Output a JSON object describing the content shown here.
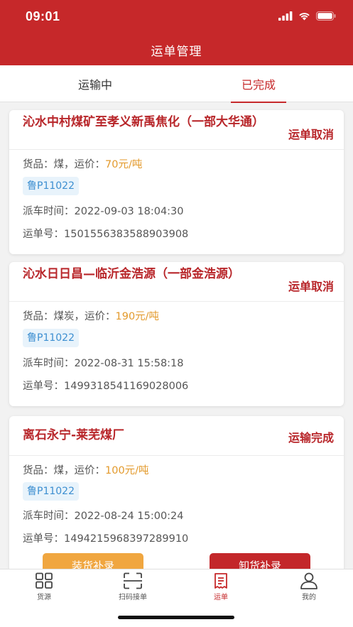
{
  "status_bar": {
    "time": "09:01"
  },
  "header": {
    "title": "运单管理"
  },
  "tabs": [
    {
      "label": "运输中",
      "active": false
    },
    {
      "label": "已完成",
      "active": true
    }
  ],
  "waybills": [
    {
      "route": "沁水中村煤矿至孝义新禹焦化（一部大华通）",
      "action": "运单取消",
      "goods_label": "货品：",
      "goods": "煤，",
      "price_label": "运价：",
      "price": "70元/吨",
      "plate": "鲁P11022",
      "dispatch_label": "派车时间：",
      "dispatch_time": "2022-09-03 18:04:30",
      "waybill_label": "运单号：",
      "waybill_no": "1501556383588903908"
    },
    {
      "route": "沁水日日昌—临沂金浩源（一部金浩源）",
      "action": "运单取消",
      "goods_label": "货品：",
      "goods": "煤炭，",
      "price_label": "运价：",
      "price": "190元/吨",
      "plate": "鲁P11022",
      "dispatch_label": "派车时间：",
      "dispatch_time": "2022-08-31 15:58:18",
      "waybill_label": "运单号：",
      "waybill_no": "1499318541169028006"
    },
    {
      "route": "离石永宁-莱芜煤厂",
      "action": "运输完成",
      "goods_label": "货品：",
      "goods": "煤，",
      "price_label": "运价：",
      "price": "100元/吨",
      "plate": "鲁P11022",
      "dispatch_label": "派车时间：",
      "dispatch_time": "2022-08-24 15:00:24",
      "waybill_label": "运单号：",
      "waybill_no": "1494215968397289910",
      "load_button": "装货补录",
      "unload_button": "卸货补录"
    }
  ],
  "bottom_nav": [
    {
      "label": "货源",
      "icon": "grid-icon",
      "active": false
    },
    {
      "label": "扫码接单",
      "icon": "scan-icon",
      "active": false
    },
    {
      "label": "运单",
      "icon": "waybill-icon",
      "active": true
    },
    {
      "label": "我的",
      "icon": "user-icon",
      "active": false
    }
  ],
  "colors": {
    "brand_red": "#c6282a",
    "price_orange": "#e39a2c",
    "plate_blue": "#3d8fd1",
    "load_button": "#f0a640"
  }
}
